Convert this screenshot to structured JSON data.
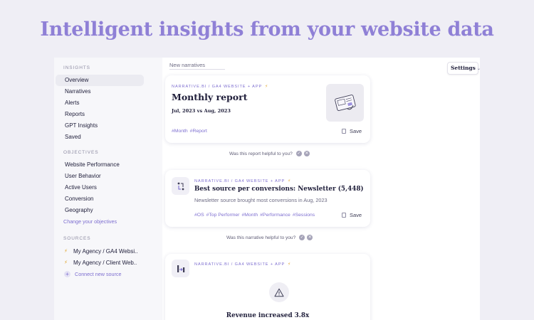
{
  "headline": "Intelligent insights from your website data",
  "sidebar": {
    "insights_heading": "INSIGHTS",
    "insights_items": [
      {
        "label": "Overview",
        "active": true
      },
      {
        "label": "Narratives"
      },
      {
        "label": "Alerts"
      },
      {
        "label": "Reports"
      },
      {
        "label": "GPT Insights"
      },
      {
        "label": "Saved"
      }
    ],
    "objectives_heading": "OBJECTIVES",
    "objectives_items": [
      {
        "label": "Website Performance"
      },
      {
        "label": "User Behavior"
      },
      {
        "label": "Active Users"
      },
      {
        "label": "Conversion"
      },
      {
        "label": "Geography"
      }
    ],
    "change_objectives": "Change your objectives",
    "sources_heading": "SOURCES",
    "sources": [
      {
        "label": "My Agency / GA4 Websi...",
        "icon": "bolt-icon"
      },
      {
        "label": "My Agency / Client Web...",
        "icon": "bolt-icon"
      }
    ],
    "connect_source": "Connect new source"
  },
  "main": {
    "section_label": "New narratives",
    "settings_label": "Settings",
    "cards": [
      {
        "source": "NARRATIVE.BI / GA4 WEBSITE + APP",
        "title": "Monthly report",
        "subtitle": "Jul, 2023 vs Aug, 2023",
        "tags": [
          "#Month",
          "#Report"
        ],
        "save_label": "Save",
        "helpful": "Was this report helpful to you?"
      },
      {
        "source": "NARRATIVE.BI / GA4 WEBSITE + APP",
        "title": "Best source per conversions: Newsletter (5,448)",
        "description": "Newsletter source brought most conversions in Aug, 2023",
        "tags": [
          "#OS",
          "#Top Performer",
          "#Month",
          "#Performance",
          "#Sessions"
        ],
        "save_label": "Save",
        "helpful": "Was this narrative helpful to you?"
      },
      {
        "source": "NARRATIVE.BI / GA4 WEBSITE + APP",
        "title": "Revenue increased 3.8x"
      }
    ]
  },
  "colors": {
    "accent": "#7e6fd0",
    "headline": "#8f80d6",
    "background": "#efeef5",
    "bolt": "#e0a42a"
  }
}
